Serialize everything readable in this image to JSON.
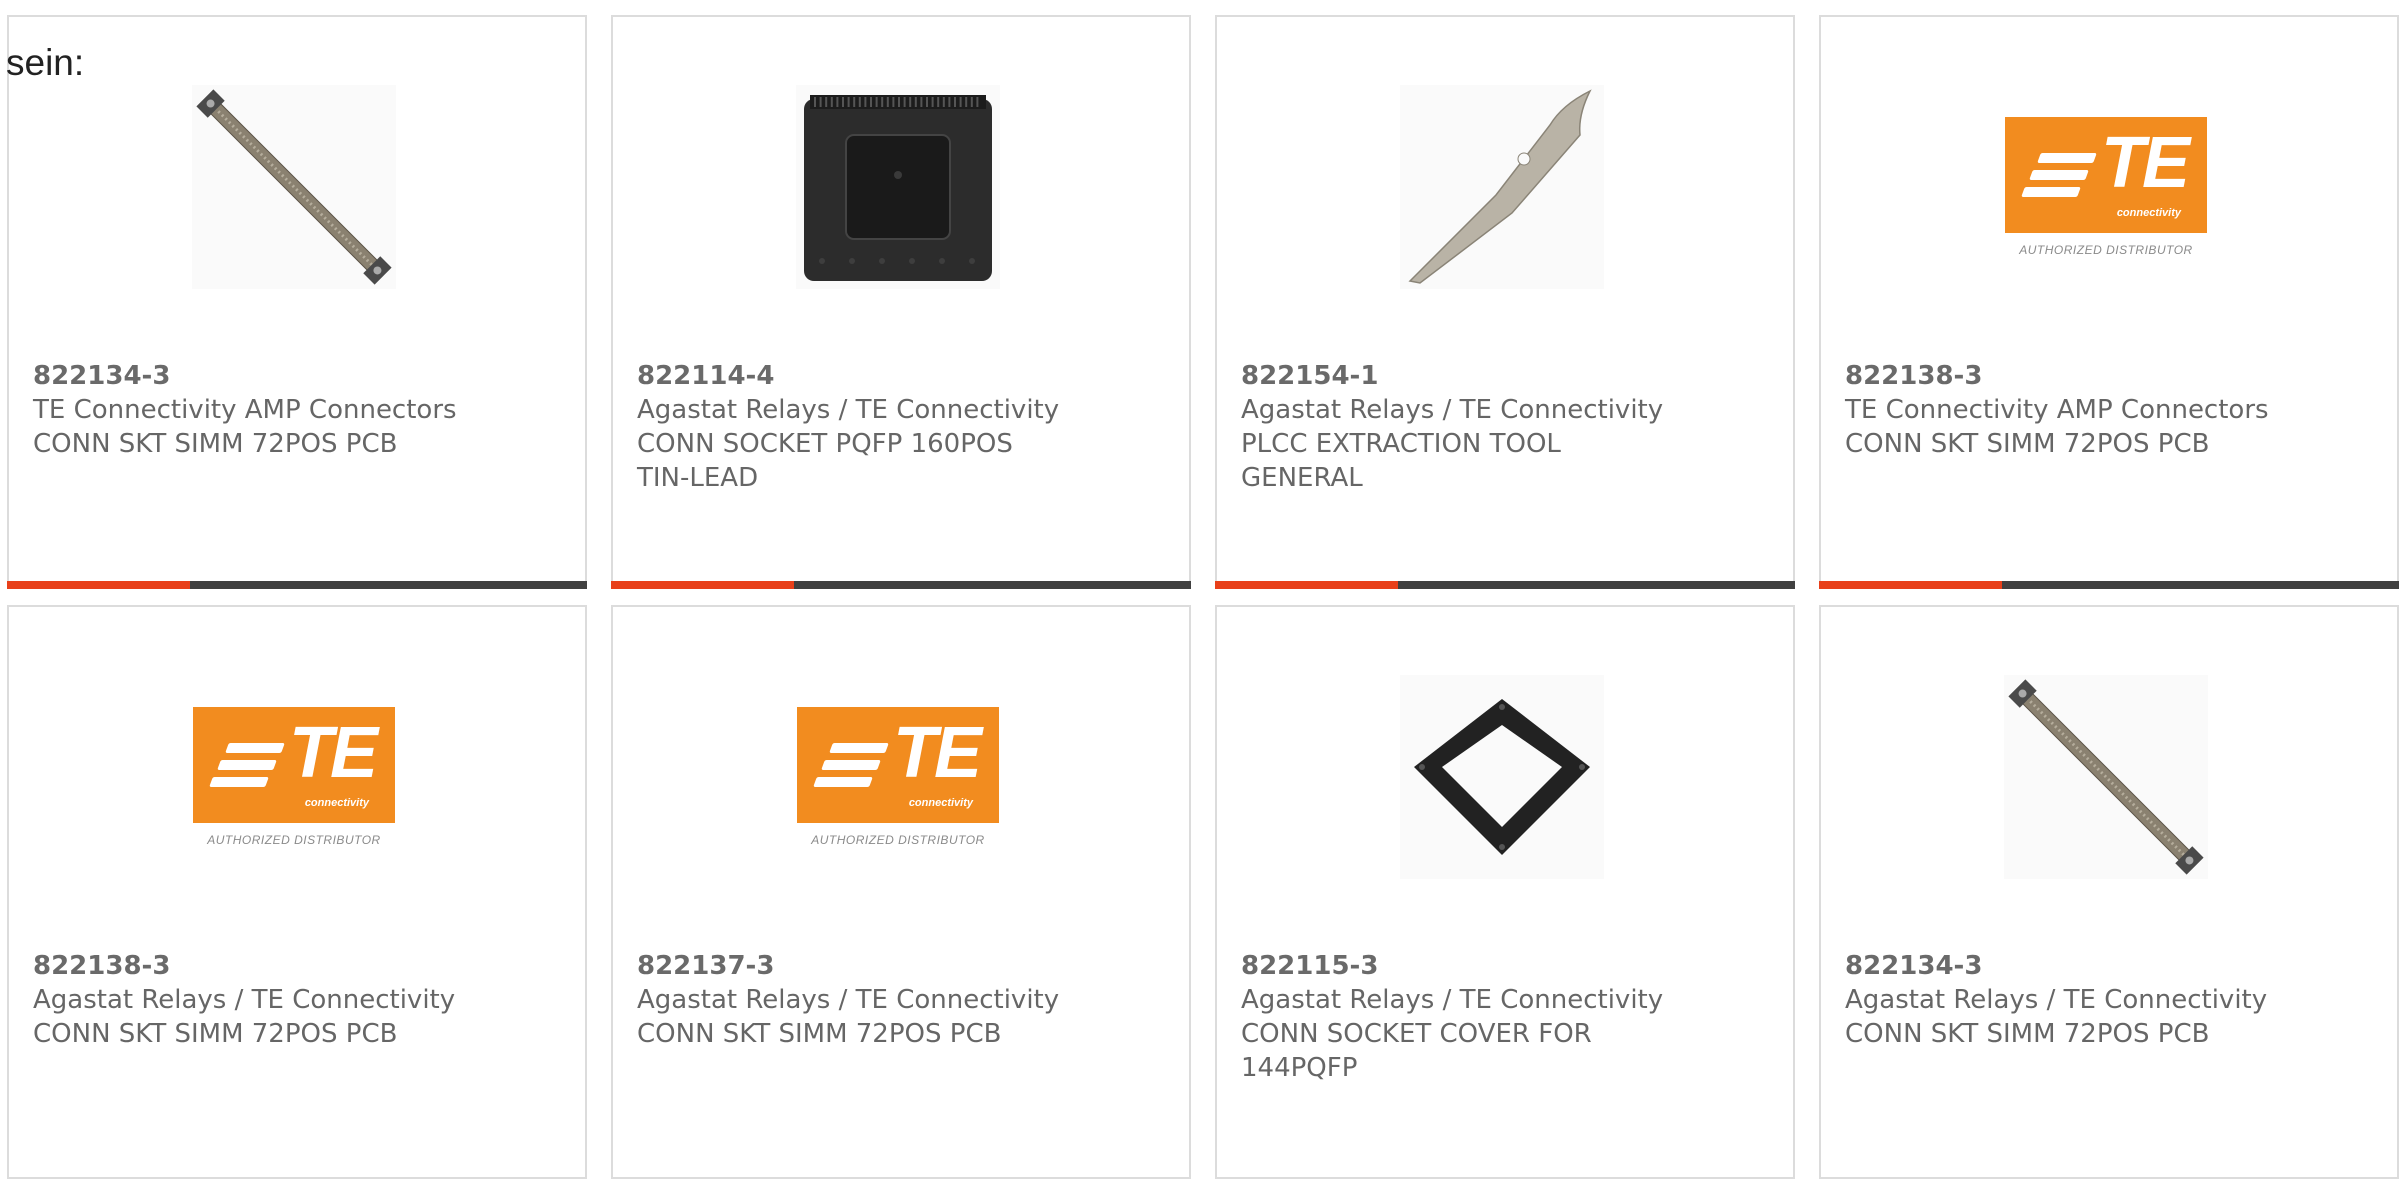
{
  "intro_text": "sein:",
  "products": [
    {
      "part": "822134-3",
      "lines": [
        "TE Connectivity AMP Connectors",
        "CONN SKT SIMM 72POS PCB"
      ],
      "image": "simm-socket"
    },
    {
      "part": "822114-4",
      "lines": [
        "Agastat Relays / TE Connectivity",
        "CONN SOCKET PQFP 160POS",
        "TIN-LEAD"
      ],
      "image": "pqfp-socket"
    },
    {
      "part": "822154-1",
      "lines": [
        "Agastat Relays / TE Connectivity",
        "PLCC EXTRACTION TOOL",
        "GENERAL"
      ],
      "image": "extraction-tool"
    },
    {
      "part": "822138-3",
      "lines": [
        "TE Connectivity AMP Connectors",
        "CONN SKT SIMM 72POS PCB"
      ],
      "image": "te-logo"
    },
    {
      "part": "822138-3",
      "lines": [
        "Agastat Relays / TE Connectivity",
        "CONN SKT SIMM 72POS PCB"
      ],
      "image": "te-logo"
    },
    {
      "part": "822137-3",
      "lines": [
        "Agastat Relays / TE Connectivity",
        "CONN SKT SIMM 72POS PCB"
      ],
      "image": "te-logo"
    },
    {
      "part": "822115-3",
      "lines": [
        "Agastat Relays / TE Connectivity",
        "CONN SOCKET COVER FOR",
        "144PQFP"
      ],
      "image": "socket-cover"
    },
    {
      "part": "822134-3",
      "lines": [
        "Agastat Relays / TE Connectivity",
        "CONN SKT SIMM 72POS PCB"
      ],
      "image": "simm-socket"
    }
  ],
  "te_logo": {
    "word": "TE",
    "sub": "connectivity",
    "distributor": "AUTHORIZED DISTRIBUTOR"
  },
  "colors": {
    "accent_bar": "#e8401a",
    "base_bar": "#404040",
    "te_orange": "#f28c1f"
  }
}
